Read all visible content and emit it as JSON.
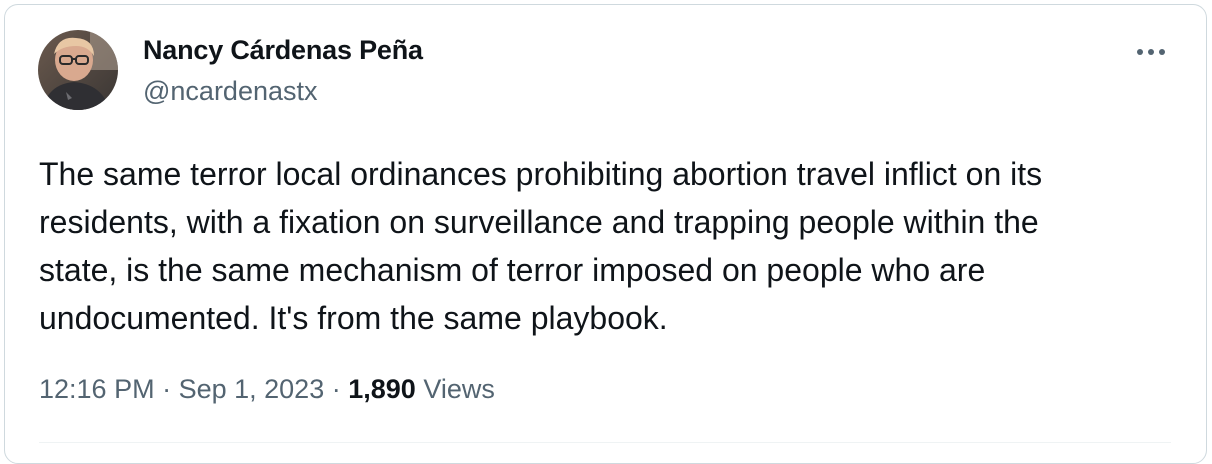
{
  "author": {
    "name": "Nancy Cárdenas Peña",
    "handle": "@ncardenastx"
  },
  "tweet": {
    "lines": [
      "The same terror local ordinances prohibiting abortion travel inflict on its",
      "residents, with a fixation on surveillance and trapping people within the",
      "state, is the same mechanism of terror imposed on people who are",
      "undocumented. It's from the same playbook."
    ],
    "time": "12:16 PM",
    "separator": " · ",
    "date": "Sep 1, 2023",
    "views_count": "1,890",
    "views_label": "Views"
  },
  "icons": {
    "more": "more-horizontal-icon"
  },
  "colors": {
    "text_primary": "#0f1419",
    "text_secondary": "#536471",
    "border": "#cfd9de"
  }
}
